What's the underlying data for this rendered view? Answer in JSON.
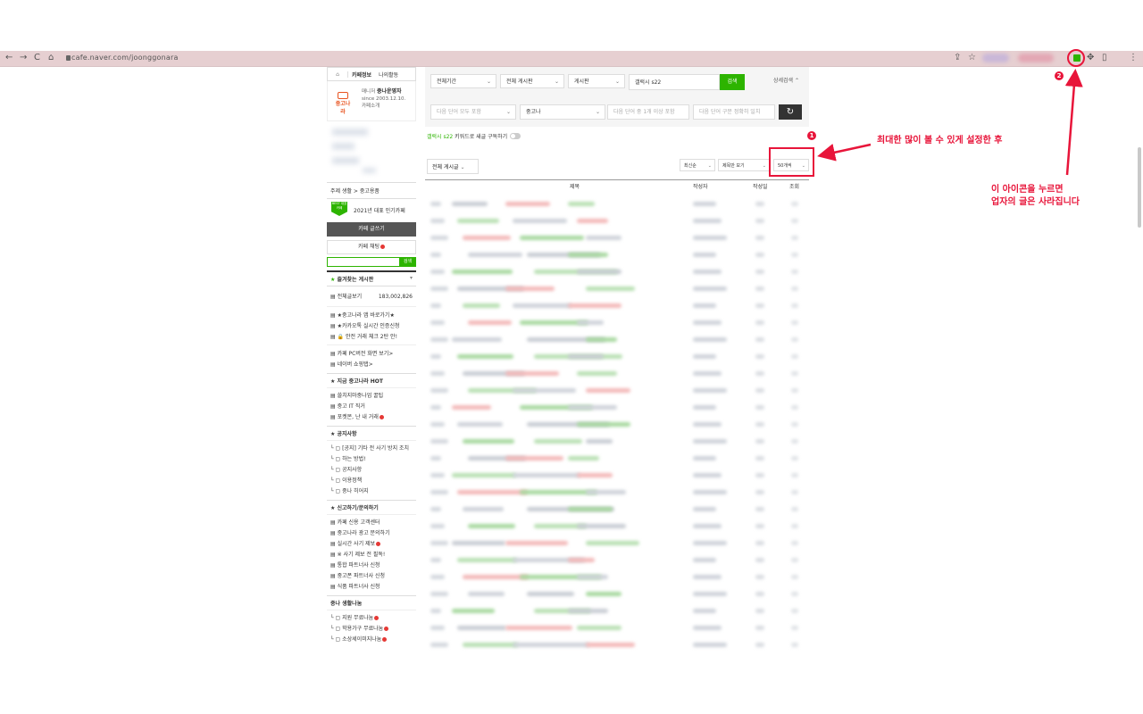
{
  "browser": {
    "url": "cafe.naver.com/joonggonara",
    "nav_back": "←",
    "nav_forward": "→",
    "nav_reload": "C",
    "nav_home": "⌂"
  },
  "sidebar": {
    "tab_cafe_info": "카페정보",
    "tab_my_activity": "나의활동",
    "manager_label": "매니저",
    "manager_name": "중나운영자",
    "since": "since 2003.12.10.",
    "cafe_intro": "카페소개",
    "logo_text": "중고나라",
    "category": "주제 생활 > 중고용품",
    "popular_badge": "BEST 대표카페",
    "popular_text": "2021년 대표 인기카페",
    "write_button": "카페 글쓰기",
    "chat_button": "카페 채팅",
    "search_button": "검색",
    "favorites_title": "즐겨찾는 게시판",
    "all_posts_label": "전체글보기",
    "all_posts_count": "183,002,826",
    "links_group1": [
      "★중고나라 앱 바로가기★",
      "★카카오톡 실시간 인증신청",
      "🔒 안전 거래 체크 2탄 안!"
    ],
    "links_group2": [
      "카페 PC버전 화면 보기>",
      "네이버 쇼핑탭>"
    ],
    "hot_title": "지금 중고나라 HOT",
    "hot_items": [
      "쓸치지마중나업 꿀팁",
      "중고 IT 직거",
      "포켓몬, 난 내 거래"
    ],
    "notice_title": "공지사항",
    "notice_items": [
      "[공지] 기타 전 사기 방지 조치",
      "하는 방법!",
      "공지사항",
      "이용정책",
      "중나 히어지"
    ],
    "report_title": "신고하기/문의하기",
    "report_items": [
      "카페 신용 고객센터",
      "중고나라 광고 문의하기",
      "실시간 사기 제보",
      "※ 사기 제보 전 필독!",
      "통합 파트너사 신청",
      "중고폰 파트너사 신청",
      "식품 파트너사 신청"
    ],
    "share_title": "중나 생활나눔",
    "share_items": [
      "지원 무료나눔",
      "학용가구 무료나눔",
      "소상세이미지나눔"
    ]
  },
  "filters": {
    "period": "전체기간",
    "board": "전체 게시판",
    "field": "게시판",
    "query": "갤럭시 s22",
    "search_button": "검색",
    "detail_search": "상세검색",
    "exclude_placeholder": "다음 단어 모두 포함",
    "product_select": "중고나",
    "include_placeholder": "다음 단어 중 1개 이상 포함",
    "exact_placeholder": "다음 단어 구문 정확히 일치",
    "reset_icon": "↻"
  },
  "keyword_sub": {
    "keyword": "갤럭시 s22",
    "rest": "키워드로 새글 구독하기"
  },
  "board_controls": {
    "all_boards": "전체 게시글",
    "sort": "최신순",
    "view": "제목만 보기",
    "per_page": "50개씩"
  },
  "table": {
    "col_title": "제목",
    "col_author": "작성자",
    "col_date": "작성일",
    "col_views": "조회"
  },
  "annotation": {
    "step1_num": "1",
    "step1_text": "최대한 많이 볼 수 있게 설정한 후",
    "step2_num": "2",
    "step2_line1": "이 아이콘을 누르면",
    "step2_line2": "업자의 글은 사라집니다"
  },
  "colors": {
    "accent": "#2db400",
    "annotation": "#e8153a",
    "browser_bar": "#e6cfd1"
  }
}
